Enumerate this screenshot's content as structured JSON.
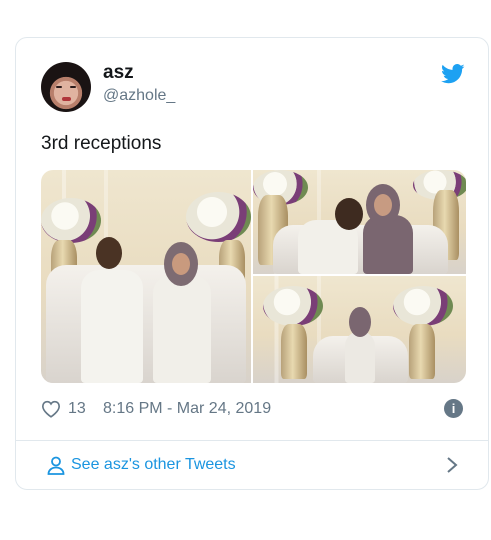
{
  "tweet": {
    "author": {
      "name": "asz",
      "handle": "@azhole_"
    },
    "text": "3rd receptions",
    "likes": "13",
    "timestamp": "8:16 PM - Mar 24, 2019",
    "footer_link": "See asz's other Tweets",
    "media_count": 3
  },
  "icons": {
    "brand": "twitter-bird-icon",
    "like": "heart-outline-icon",
    "info": "info-icon",
    "user": "user-outline-icon",
    "chevron": "chevron-right-icon"
  },
  "colors": {
    "name": "#14171a",
    "secondary": "#657786",
    "link": "#1b95e0",
    "border": "#e1e8ed"
  }
}
